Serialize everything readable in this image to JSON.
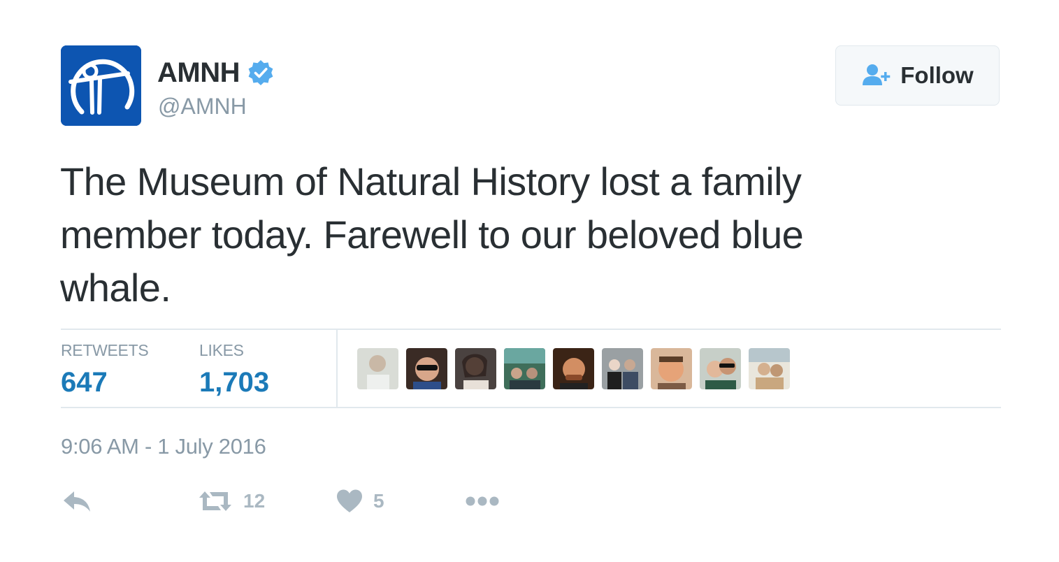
{
  "author": {
    "display_name": "AMNH",
    "handle": "@AMNH",
    "verified": true,
    "avatar_icon": "amnh-logo-icon",
    "avatar_color": "#0d55b1"
  },
  "follow_button": {
    "label": "Follow",
    "icon": "add-user-icon"
  },
  "tweet": {
    "text": "The Museum of Natural History lost a family member today. Farewell to our beloved blue whale."
  },
  "stats": {
    "retweets_label": "RETWEETS",
    "retweets_value": "647",
    "likes_label": "LIKES",
    "likes_value": "1,703",
    "liker_avatars_count": 9
  },
  "timestamp": "9:06 AM - 1 July 2016",
  "actions": {
    "reply_icon": "reply-icon",
    "retweet_icon": "retweet-icon",
    "retweet_count": "12",
    "like_icon": "heart-icon",
    "like_count": "5",
    "more_icon": "more-dots-icon"
  },
  "colors": {
    "text": "#292f33",
    "secondary": "#8899a6",
    "stat_value": "#1b7ab8",
    "action_gray": "#aab8c2",
    "verified_blue": "#55acee",
    "border": "#e1e8ed"
  }
}
